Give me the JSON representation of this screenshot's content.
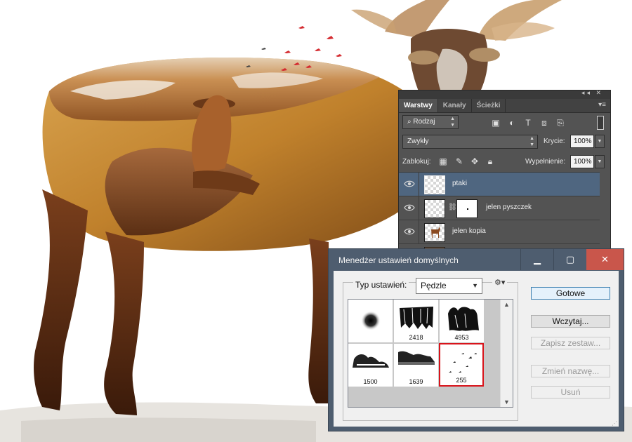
{
  "layers_panel": {
    "tabs": [
      "Warstwy",
      "Kanały",
      "Ścieżki"
    ],
    "filter_kind": "Rodzaj",
    "blend_mode": "Zwykły",
    "opacity_label": "Krycie:",
    "opacity_value": "100%",
    "lock_label": "Zablokuj:",
    "fill_label": "Wypełnienie:",
    "fill_value": "100%",
    "layers": [
      {
        "name": "ptaki",
        "selected": true
      },
      {
        "name": "jelen pyszczek",
        "selected": false
      },
      {
        "name": "jelen kopia",
        "selected": false
      }
    ]
  },
  "preset_dialog": {
    "title": "Menedżer ustawień domyślnych",
    "preset_type_label": "Typ ustawień:",
    "preset_type_value": "Pędzle",
    "brushes": [
      {
        "size": ""
      },
      {
        "size": "2418"
      },
      {
        "size": "4953"
      },
      {
        "size": "1500"
      },
      {
        "size": "1639"
      },
      {
        "size": "255"
      }
    ],
    "selected_brush_index": 5,
    "buttons": {
      "done": "Gotowe",
      "load": "Wczytaj...",
      "save_set": "Zapisz zestaw...",
      "rename": "Zmień nazwę...",
      "delete": "Usuń"
    }
  },
  "colors": {
    "panel_bg": "#535353",
    "selected_layer": "#4f6680",
    "dialog_frame": "#4e5d6f",
    "close_button": "#c9564b",
    "selected_brush_border": "#d8141b"
  }
}
